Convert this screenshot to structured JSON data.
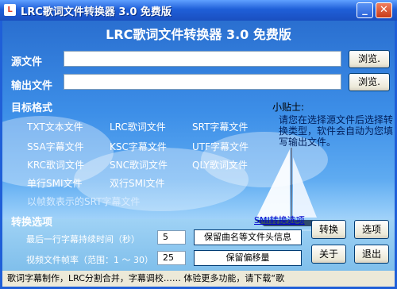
{
  "window": {
    "title": "LRC歌词文件转换器 3.0 免费版",
    "icon_text": "L",
    "min_glyph": "_",
    "close_glyph": "✕"
  },
  "heading": "LRC歌词文件转换器 3.0 免费版",
  "source": {
    "label": "源文件",
    "value": "",
    "browse_label": "浏览."
  },
  "output": {
    "label": "输出文件",
    "value": "",
    "browse_label": "浏览."
  },
  "target_format": {
    "label": "目标格式",
    "formats": [
      "TXT文本文件",
      "LRC歌词文件",
      "SRT字幕文件",
      "SSA字幕文件",
      "KSC字幕文件",
      "UTF字幕文件",
      "KRC歌词文件",
      "SNC歌词文件",
      "QLY歌词文件",
      "单行SMI文件",
      "双行SMI文件",
      "以帧数表示的SRT字幕文件"
    ]
  },
  "tip": {
    "title": "小贴士:",
    "text": "请您在选择源文件后选择转换类型，软件会自动为您填写输出文件。"
  },
  "options": {
    "label": "转换选项",
    "smi_link": "SMI转换选项",
    "last_line_label": "最后一行字幕持续时间（秒）",
    "last_line_value": "5",
    "keep_title_label": "保留曲名等文件头信息",
    "framerate_label": "视频文件帧率（范围：1 ～ 30）",
    "framerate_value": "25",
    "keep_offset_label": "保留偏移量"
  },
  "buttons": {
    "convert": "转换",
    "options": "选项",
    "about": "关于",
    "exit": "退出"
  },
  "status": "歌词字幕制作，LRC分割合并，字幕调校…… 体验更多功能，请下载“歌"
}
